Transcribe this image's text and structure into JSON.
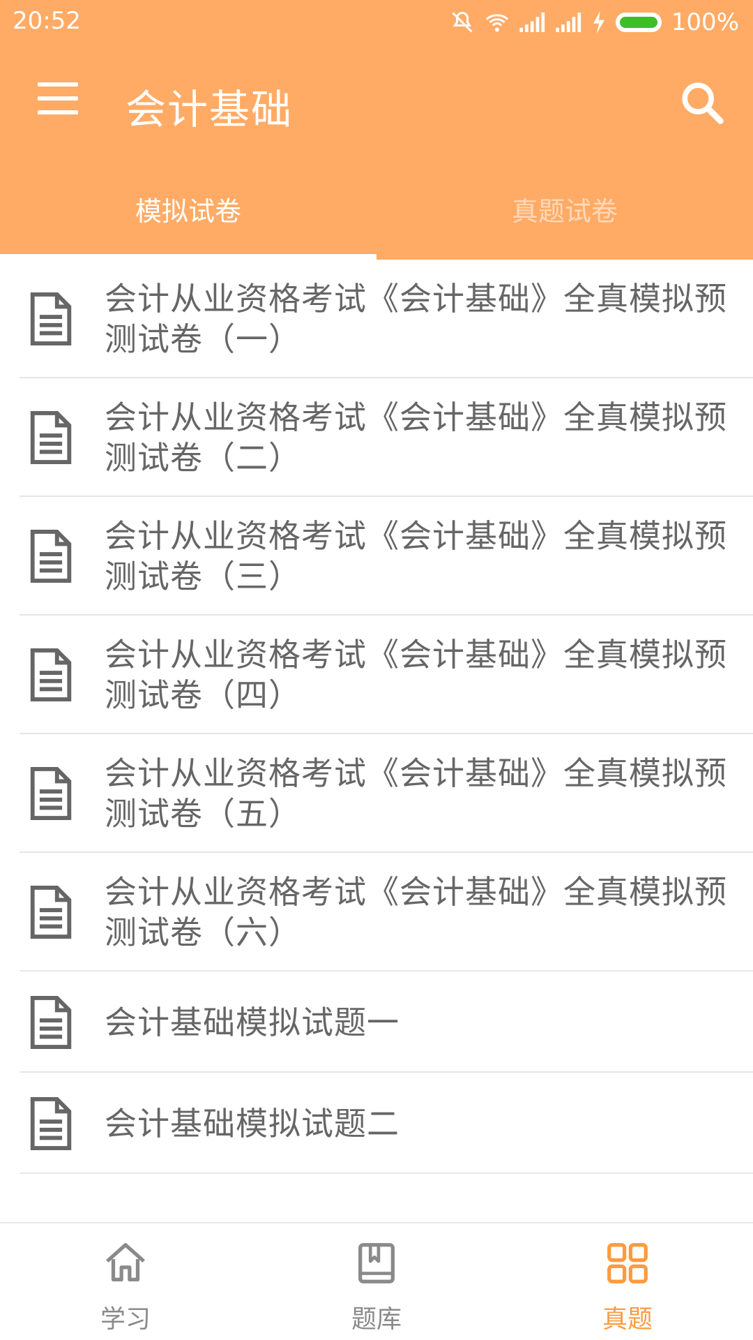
{
  "status": {
    "time": "20:52",
    "battery": "100%"
  },
  "appbar": {
    "title": "会计基础"
  },
  "tabs": [
    {
      "label": "模拟试卷",
      "active": true
    },
    {
      "label": "真题试卷",
      "active": false
    }
  ],
  "list": [
    {
      "title": "会计从业资格考试《会计基础》全真模拟预测试卷（一）"
    },
    {
      "title": "会计从业资格考试《会计基础》全真模拟预测试卷（二）"
    },
    {
      "title": "会计从业资格考试《会计基础》全真模拟预测试卷（三）"
    },
    {
      "title": "会计从业资格考试《会计基础》全真模拟预测试卷（四）"
    },
    {
      "title": "会计从业资格考试《会计基础》全真模拟预测试卷（五）"
    },
    {
      "title": "会计从业资格考试《会计基础》全真模拟预测试卷（六）"
    },
    {
      "title": "会计基础模拟试题一"
    },
    {
      "title": "会计基础模拟试题二"
    }
  ],
  "bottom_nav": [
    {
      "label": "学习",
      "icon": "home-icon",
      "active": false
    },
    {
      "label": "题库",
      "icon": "book-icon",
      "active": false
    },
    {
      "label": "真题",
      "icon": "grid-icon",
      "active": true
    }
  ],
  "colors": {
    "primary": "#FFAB66",
    "active_nav": "#FF9A3F",
    "text": "#666666"
  }
}
